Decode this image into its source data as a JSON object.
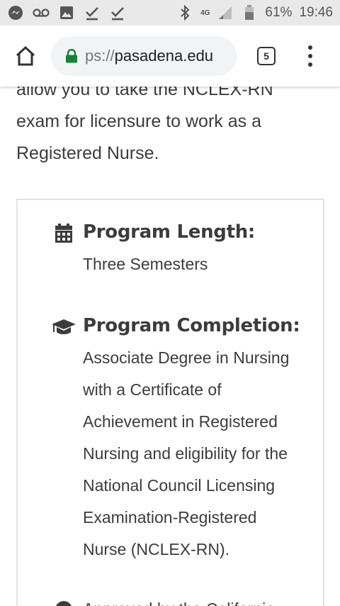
{
  "status_bar": {
    "left_icons": [
      "messenger-icon",
      "voicemail-icon",
      "image-icon",
      "check-icon",
      "check-icon"
    ],
    "right_icons": [
      "bluetooth-icon",
      "signal-icon",
      "battery-icon"
    ],
    "network": "4G",
    "battery": "61%",
    "time": "19:46"
  },
  "toolbar": {
    "url_scheme": "ps://",
    "url_host": "pasadena.edu",
    "tab_count": "5"
  },
  "content": {
    "intro_lines": [
      "allow you to take the NCLEX-RN",
      "exam for licensure to work as a",
      "Registered Nurse."
    ],
    "items": [
      {
        "icon": "calendar-icon",
        "title": "Program Length:",
        "desc_lines": [
          "Three Semesters"
        ]
      },
      {
        "icon": "graduation-cap-icon",
        "title": "Program Completion:",
        "desc_lines": [
          "Associate Degree in Nursing",
          "with a Certificate of",
          "Achievement in Registered",
          "Nursing and eligibility for the",
          "National Council Licensing",
          "Examination-Registered",
          "Nurse (NCLEX-RN)."
        ]
      },
      {
        "icon": "circle-icon",
        "title": "",
        "desc_lines": [
          "Approved by the California"
        ]
      }
    ]
  }
}
